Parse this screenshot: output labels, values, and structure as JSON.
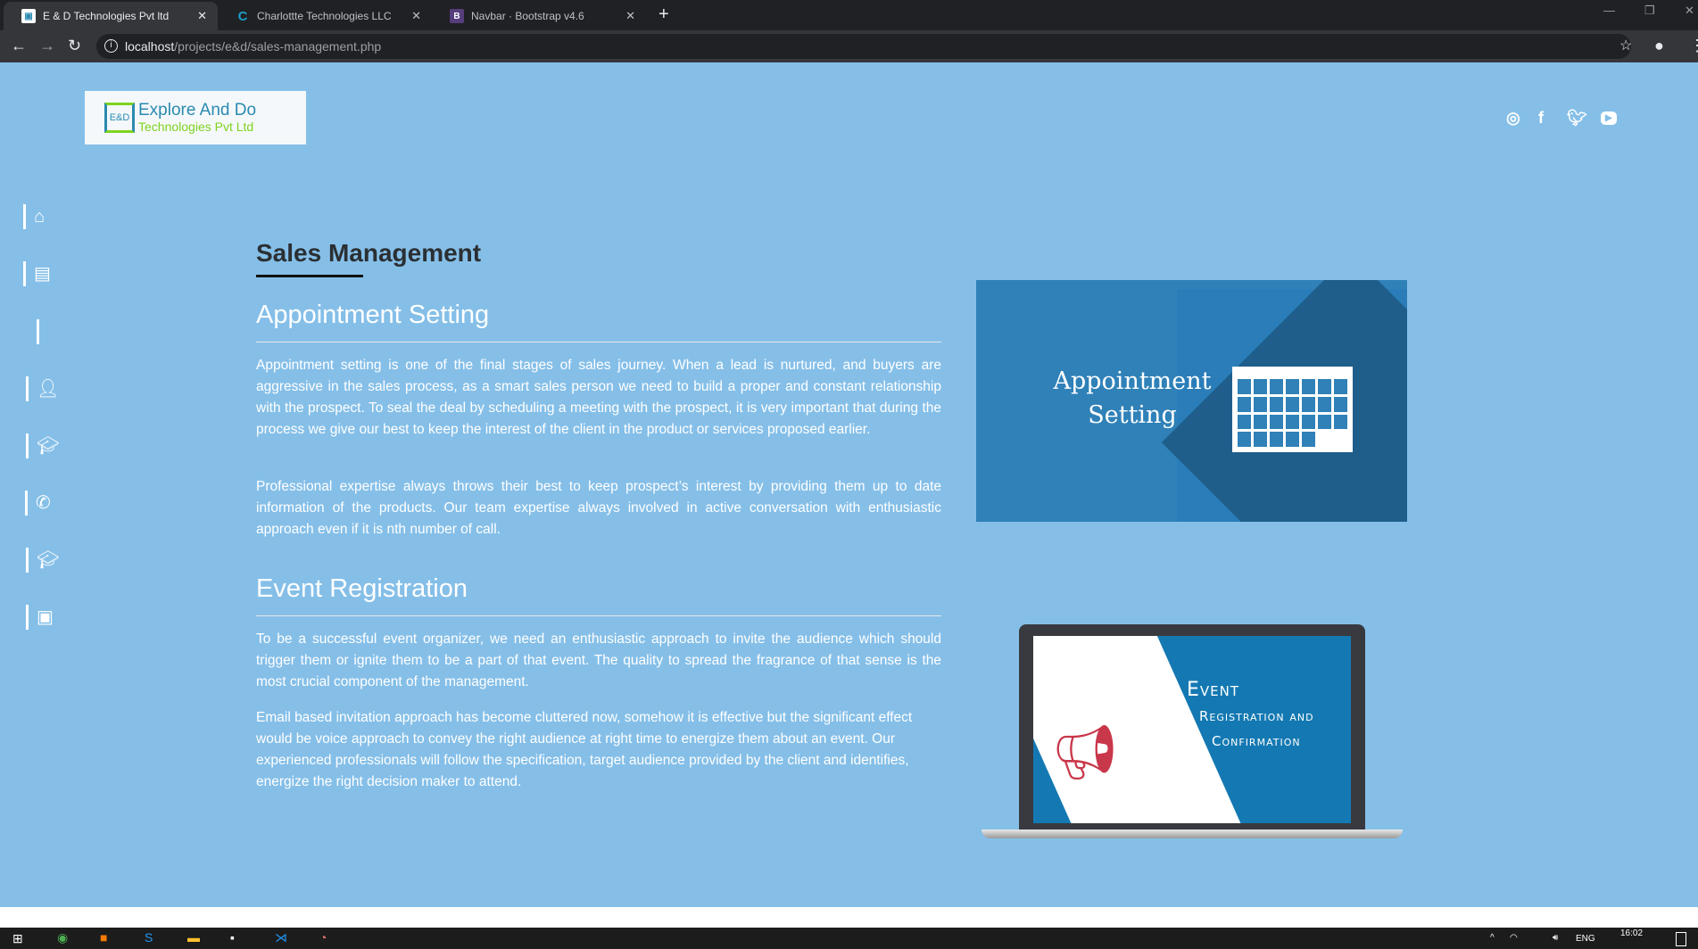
{
  "browser": {
    "tabs": [
      {
        "title": "E & D Technologies Pvt ltd",
        "active": true
      },
      {
        "title": "Charlottte Technologies LLC",
        "active": false
      },
      {
        "title": "Navbar · Bootstrap v4.6",
        "active": false
      }
    ],
    "url_host": "localhost",
    "url_path": "/projects/e&d/sales-management.php"
  },
  "logo": {
    "mark": "E&D",
    "line1": "Explore And Do",
    "line2": "Technologies Pvt Ltd"
  },
  "social": [
    "instagram-icon",
    "facebook-icon",
    "twitter-icon",
    "youtube-icon"
  ],
  "sidebar": [
    "home-icon",
    "id-card-icon",
    "blank",
    "user-shield-icon",
    "graduate-icon",
    "phone-volume-icon",
    "graduate-icon",
    "address-book-icon"
  ],
  "page": {
    "title": "Sales Management",
    "sections": [
      {
        "heading": "Appointment Setting",
        "paragraphs": [
          "Appointment setting is one of the final stages of sales journey. When a lead is nurtured, and buyers are aggressive in the sales process, as a smart sales person we need to build a proper and constant relationship with the prospect. To seal the deal by scheduling a meeting with the prospect, it is very important that during the process we give our best to keep the interest of the client in the product or services proposed earlier.",
          "Professional expertise always throws their best to keep prospect’s interest by providing them up to date information of the products. Our team expertise always involved in active conversation with enthusiastic approach even if it is nth number of call."
        ]
      },
      {
        "heading": "Event Registration",
        "paragraphs": [
          "To be a successful event organizer, we need an enthusiastic approach to invite the audience which should trigger them or ignite them to be a part of that event. The quality to spread the fragrance of that sense is the most crucial component of the management.",
          "Email based invitation approach has become cluttered now, somehow it is effective but the significant effect would be voice approach to convey the right audience at right time to energize them about an event. Our experienced professionals will follow the specification, target audience provided by the client and identifies, energize the right decision maker to attend."
        ]
      }
    ]
  },
  "images": {
    "appointment": {
      "line1": "Appointment",
      "line2": "Setting"
    },
    "event": {
      "line1": "Event",
      "line2": "Registration and",
      "line3": "Confirmation"
    }
  },
  "taskbar": {
    "lang": "ENG",
    "time": "16:02"
  }
}
